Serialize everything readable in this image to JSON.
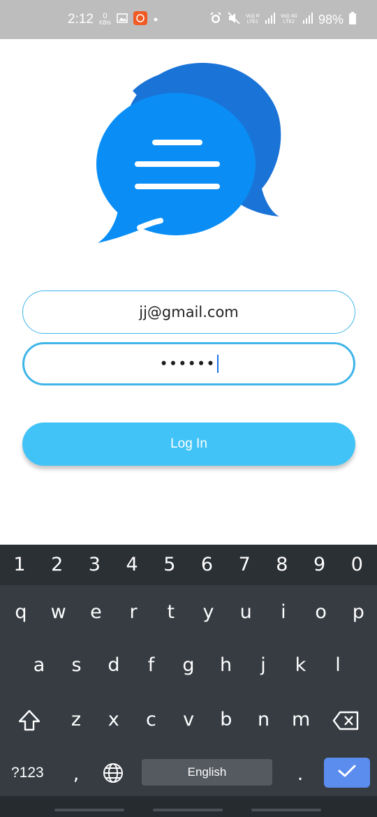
{
  "status_bar": {
    "time": "2:12",
    "net_speed_value": "0",
    "net_speed_unit": "KB/s",
    "sim1_label": "Vo)) R\nLTE1",
    "sim2_label": "Vo)) 4G\nLTE2",
    "battery": "98%"
  },
  "form": {
    "email_value": "jj@gmail.com",
    "password_value": "••••••"
  },
  "login_button": {
    "label": "Log In"
  },
  "keyboard": {
    "number_row": [
      "1",
      "2",
      "3",
      "4",
      "5",
      "6",
      "7",
      "8",
      "9",
      "0"
    ],
    "row1": [
      "q",
      "w",
      "e",
      "r",
      "t",
      "y",
      "u",
      "i",
      "o",
      "p"
    ],
    "row2": [
      "a",
      "s",
      "d",
      "f",
      "g",
      "h",
      "j",
      "k",
      "l"
    ],
    "row3": [
      "z",
      "x",
      "c",
      "v",
      "b",
      "n",
      "m"
    ],
    "symbols_label": "?123",
    "comma": ",",
    "period": ".",
    "space_label": "English"
  },
  "colors": {
    "accent": "#42c3f7",
    "field_border": "#3fb5e8",
    "bubble_front": "#0a8ef5",
    "bubble_back": "#1a73d6",
    "keyboard_bg": "#363c42",
    "enter_key": "#5b8def"
  }
}
